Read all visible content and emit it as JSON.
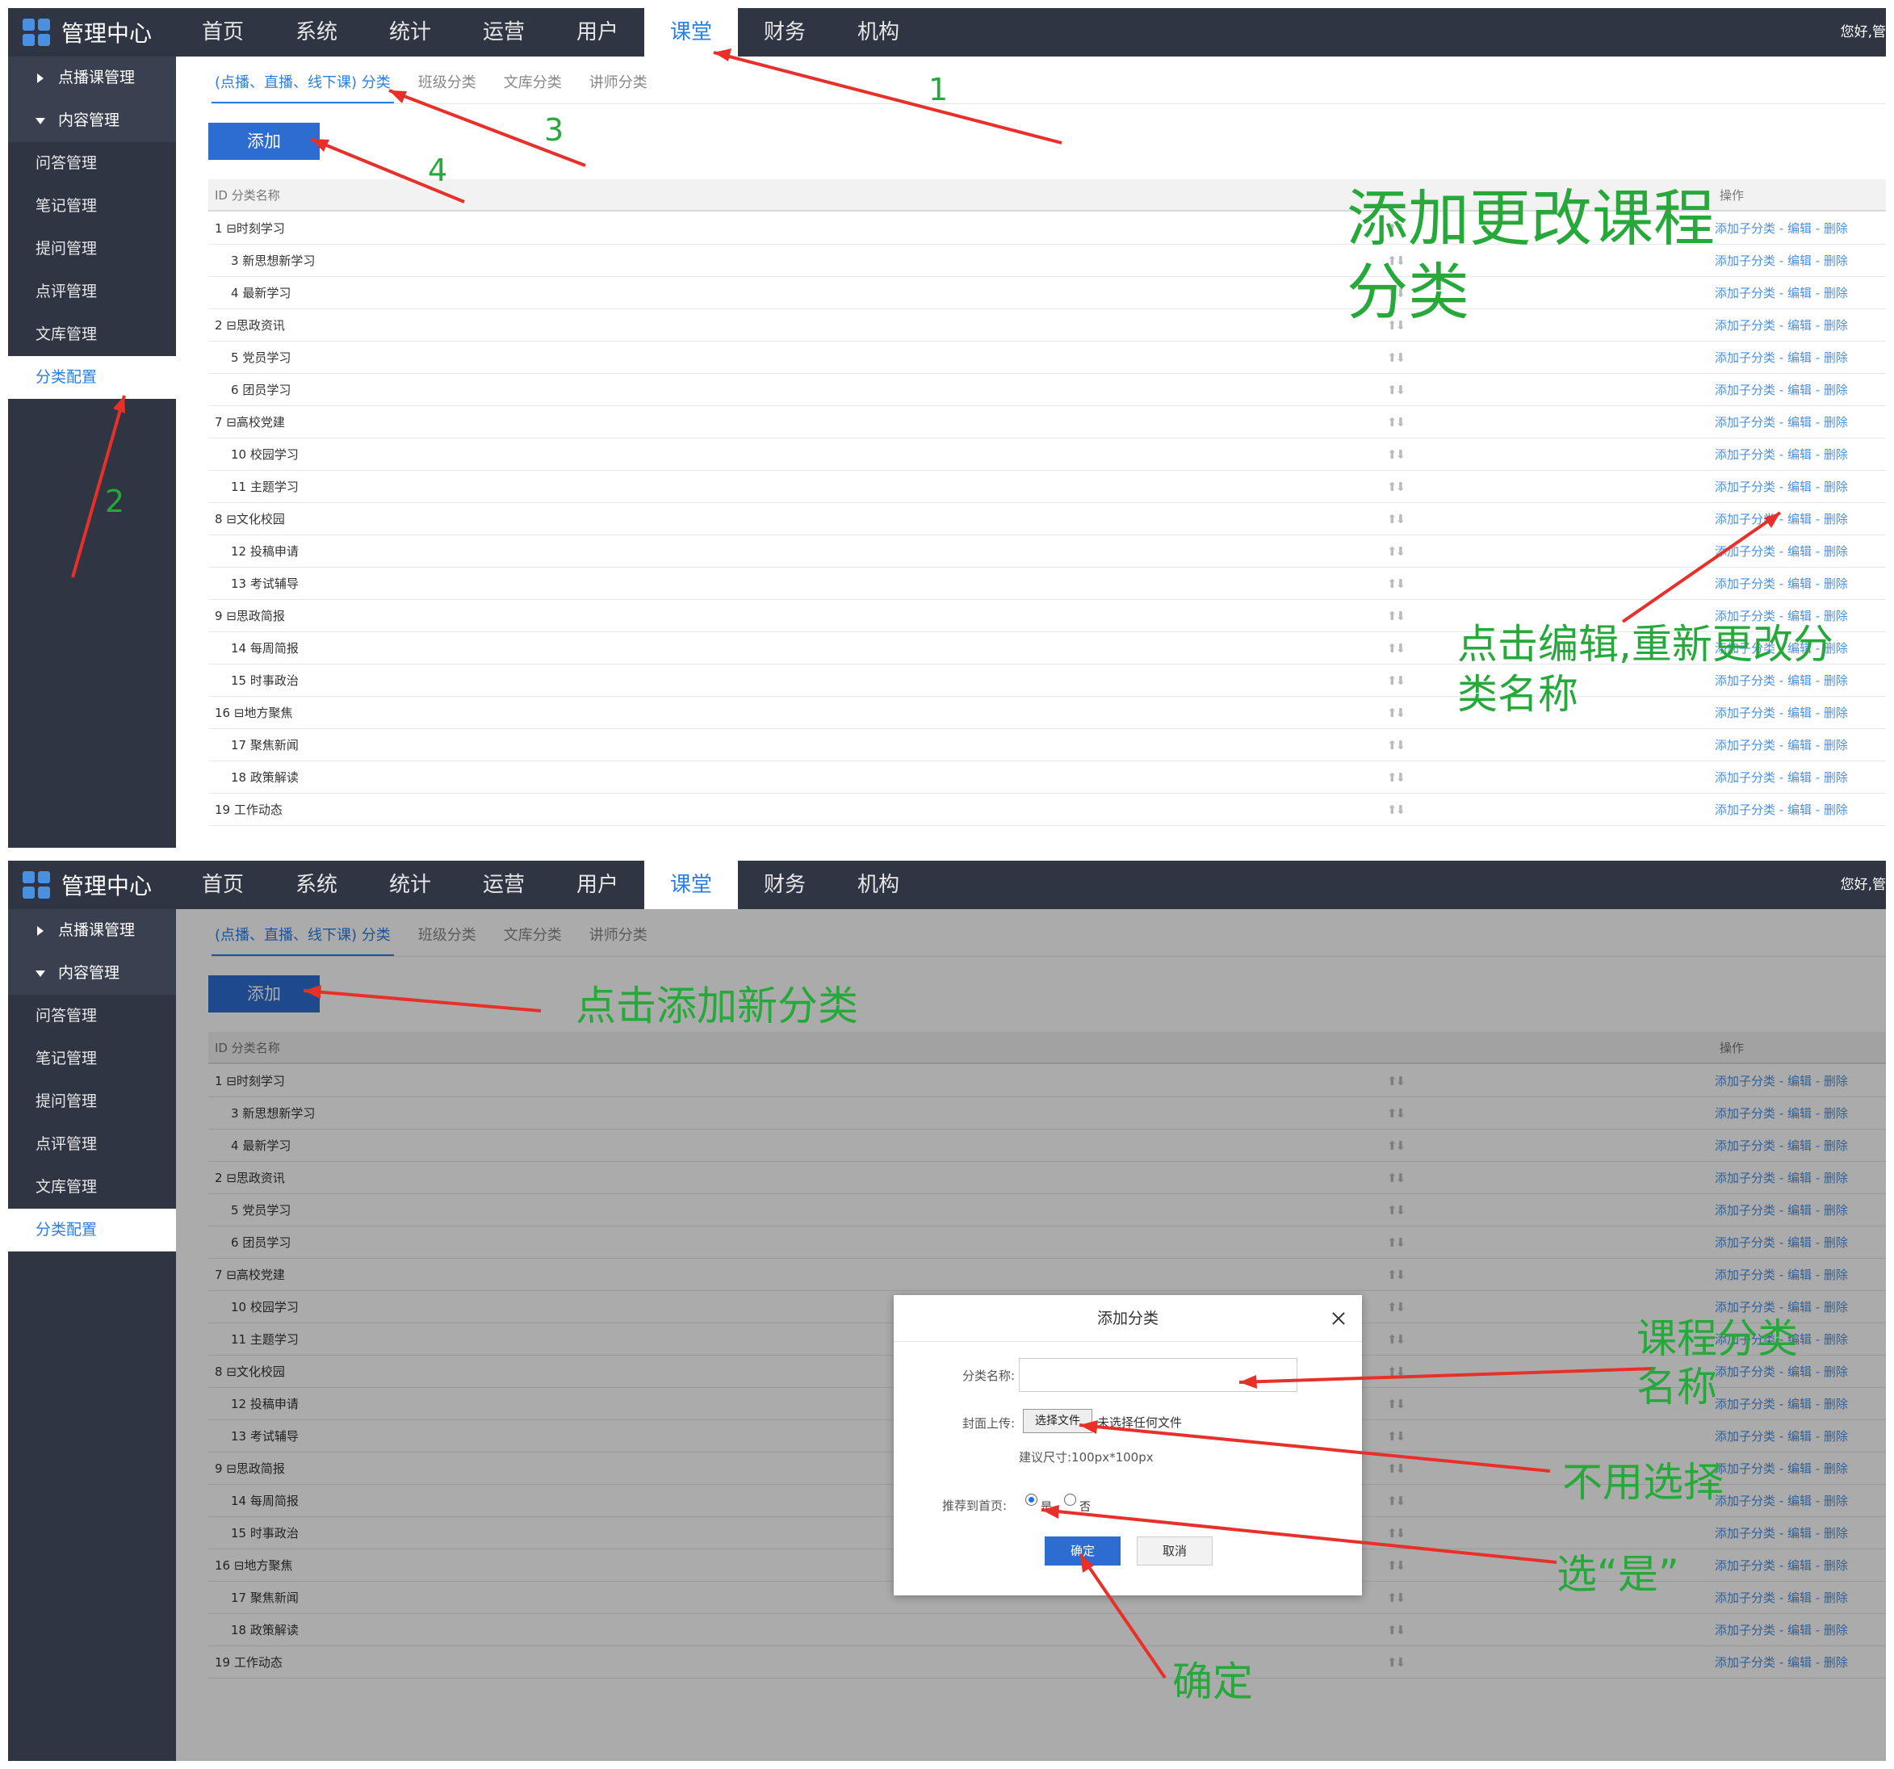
{
  "app": {
    "title": "管理中心",
    "greeting": "您好,管"
  },
  "nav": [
    "首页",
    "系统",
    "统计",
    "运营",
    "用户",
    "课堂",
    "财务",
    "机构"
  ],
  "nav_active": "课堂",
  "sidebar": {
    "group1": "点播课管理",
    "group2": "内容管理",
    "items": [
      "问答管理",
      "笔记管理",
      "提问管理",
      "点评管理",
      "文库管理",
      "分类配置"
    ],
    "active": "分类配置"
  },
  "tabs": [
    "(点播、直播、线下课) 分类",
    "班级分类",
    "文库分类",
    "讲师分类"
  ],
  "add_button": "添加",
  "table": {
    "col_id_name": "ID 分类名称",
    "col_ops": "操作",
    "ops_text": "添加子分类 - 编辑 - 删除",
    "sort_icon": "up-down-arrows",
    "rows": [
      {
        "id": "1",
        "name": "⊟时刻学习",
        "child": false
      },
      {
        "id": "3",
        "name": "新思想新学习",
        "child": true
      },
      {
        "id": "4",
        "name": "最新学习",
        "child": true
      },
      {
        "id": "2",
        "name": "⊟思政资讯",
        "child": false
      },
      {
        "id": "5",
        "name": "党员学习",
        "child": true
      },
      {
        "id": "6",
        "name": "团员学习",
        "child": true
      },
      {
        "id": "7",
        "name": "⊟高校党建",
        "child": false
      },
      {
        "id": "10",
        "name": "校园学习",
        "child": true
      },
      {
        "id": "11",
        "name": "主题学习",
        "child": true
      },
      {
        "id": "8",
        "name": "⊟文化校园",
        "child": false
      },
      {
        "id": "12",
        "name": "投稿申请",
        "child": true
      },
      {
        "id": "13",
        "name": "考试辅导",
        "child": true
      },
      {
        "id": "9",
        "name": "⊟思政简报",
        "child": false
      },
      {
        "id": "14",
        "name": "每周简报",
        "child": true
      },
      {
        "id": "15",
        "name": "时事政治",
        "child": true
      },
      {
        "id": "16",
        "name": "⊟地方聚焦",
        "child": false
      },
      {
        "id": "17",
        "name": "聚焦新闻",
        "child": true
      },
      {
        "id": "18",
        "name": "政策解读",
        "child": true
      },
      {
        "id": "19",
        "name": "工作动态",
        "child": false
      }
    ]
  },
  "modal": {
    "title": "添加分类",
    "name_label": "分类名称:",
    "name_value": "",
    "cover_label": "封面上传:",
    "file_button": "选择文件",
    "file_status": "未选择任何文件",
    "size_hint": "建议尺寸:100px*100px",
    "recommend_label": "推荐到首页:",
    "opt_yes": "是",
    "opt_no": "否",
    "selected": "是",
    "ok": "确定",
    "cancel": "取消"
  },
  "annotations": {
    "n1": "1",
    "n2": "2",
    "n3": "3",
    "n4": "4",
    "title_top": "添加更改课程分类",
    "edit_note_1": "点击编辑,重新更改分",
    "edit_note_2": "类名称",
    "click_add": "点击添加新分类",
    "course_name_1": "课程分类",
    "course_name_2": "名称",
    "no_select": "不用选择",
    "choose_yes": "选“是”",
    "confirm": "确定"
  },
  "colors": {
    "topbar": "#2f3542",
    "accent": "#2d7ee0",
    "arrow": "#e8302a",
    "annotation": "#27a83a"
  }
}
